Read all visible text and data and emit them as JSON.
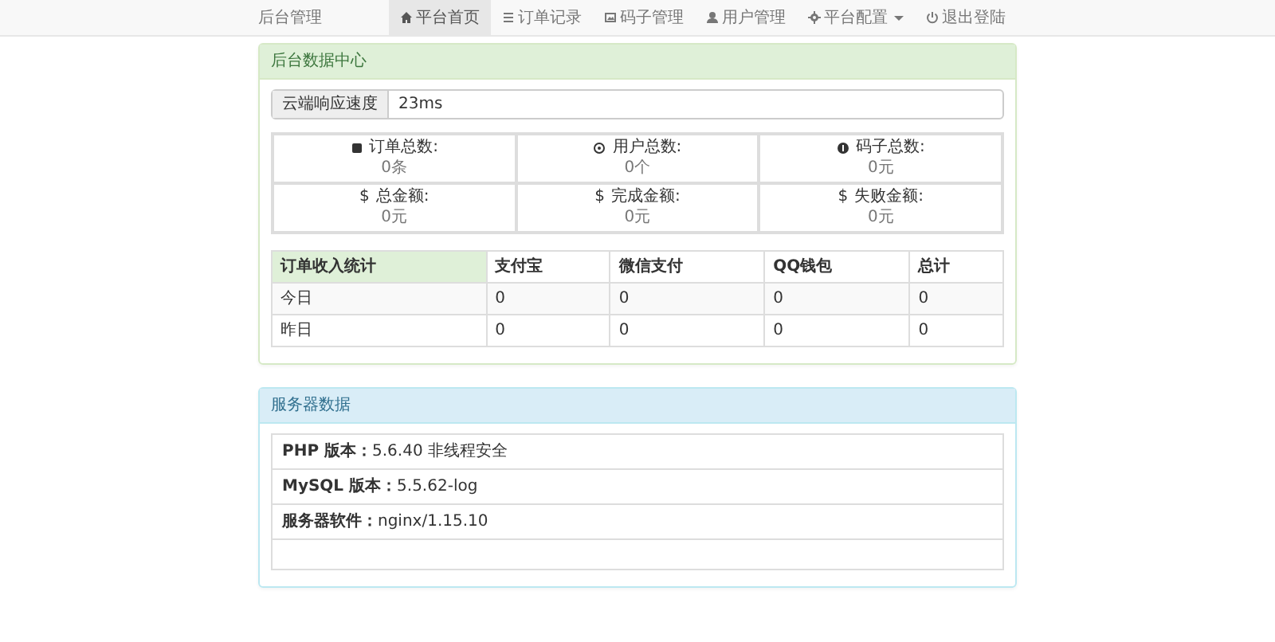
{
  "navbar": {
    "brand": "后台管理",
    "items": [
      {
        "label": "平台首页",
        "selected": true,
        "dropdown": false
      },
      {
        "label": "订单记录",
        "selected": false,
        "dropdown": false
      },
      {
        "label": "码子管理",
        "selected": false,
        "dropdown": false
      },
      {
        "label": "用户管理",
        "selected": false,
        "dropdown": false
      },
      {
        "label": "平台配置",
        "selected": false,
        "dropdown": true
      },
      {
        "label": "退出登陆",
        "selected": false,
        "dropdown": false
      }
    ]
  },
  "data_panel": {
    "title": "后台数据中心",
    "speed": {
      "label": "云端响应速度",
      "value": "23ms"
    },
    "stats": [
      {
        "label": "订单总数:",
        "value": "0条"
      },
      {
        "label": "用户总数:",
        "value": "0个"
      },
      {
        "label": "码子总数:",
        "value": "0元"
      },
      {
        "symbol": "$",
        "label": "总金额:",
        "value": "0元"
      },
      {
        "symbol": "$",
        "label": "完成金额:",
        "value": "0元"
      },
      {
        "symbol": "$",
        "label": "失败金额:",
        "value": "0元"
      }
    ],
    "income_table": {
      "columns": [
        "订单收入统计",
        "支付宝",
        "微信支付",
        "QQ钱包",
        "总计"
      ],
      "rows": [
        [
          "今日",
          "0",
          "0",
          "0",
          "0"
        ],
        [
          "昨日",
          "0",
          "0",
          "0",
          "0"
        ]
      ]
    }
  },
  "server_panel": {
    "title": "服务器数据",
    "items": [
      {
        "label": "PHP 版本：",
        "value": "5.6.40 非线程安全"
      },
      {
        "label": "MySQL 版本：",
        "value": "5.5.62-log"
      },
      {
        "label": "服务器软件：",
        "value": "nginx/1.15.10"
      }
    ]
  }
}
